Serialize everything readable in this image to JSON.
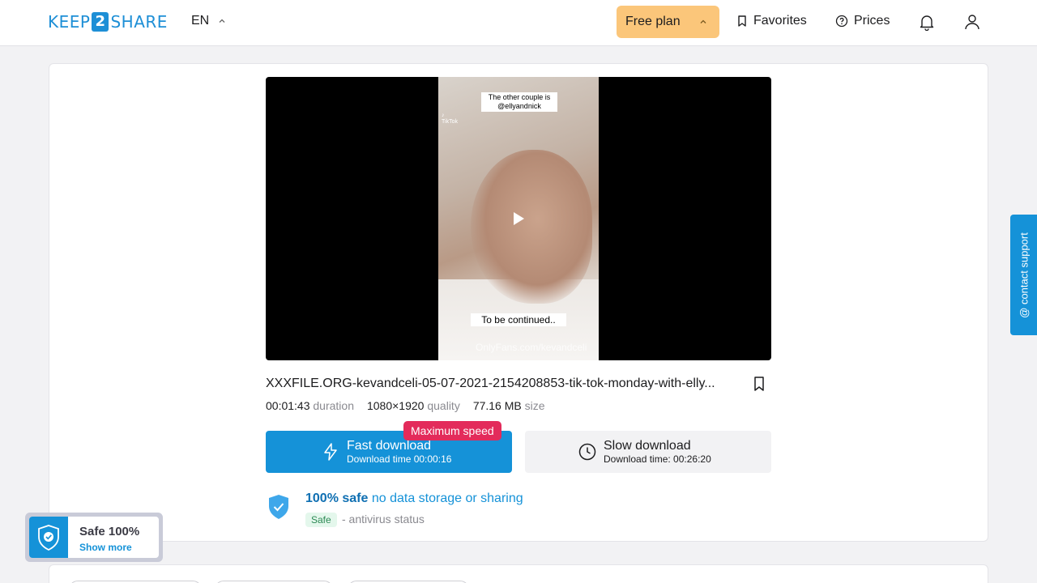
{
  "header": {
    "logo": {
      "pre": "KEEP",
      "num": "2",
      "post": "SHARE"
    },
    "language": "EN",
    "free_plan_label": "Free plan",
    "favorites_label": "Favorites",
    "prices_label": "Prices",
    "icons": {
      "bookmark": "bookmark-icon",
      "help": "help-circle-icon",
      "bell": "bell-icon",
      "user": "user-icon"
    }
  },
  "video": {
    "caption_top": "The other couple is @ellyandnick",
    "caption_bottom": "To be continued..",
    "watermark": "OnlyFans.com/kevandceli",
    "tiktok_label": "TikTok"
  },
  "file": {
    "name": "XXXFILE.ORG-kevandceli-05-07-2021-2154208853-tik-tok-monday-with-elly...",
    "duration_value": "00:01:43",
    "duration_label": "duration",
    "quality_value": "1080×1920",
    "quality_label": "quality",
    "size_value": "77.16 MB",
    "size_label": "size"
  },
  "download": {
    "fast_title": "Fast download",
    "fast_sub": "Download time 00:00:16",
    "max_speed_badge": "Maximum speed",
    "slow_title": "Slow download",
    "slow_sub": "Download time: 00:26:20"
  },
  "safety": {
    "bold": "100% safe",
    "rest": "no data storage or sharing",
    "tag": "Safe",
    "status": "- antivirus status"
  },
  "support_label": "@ contact support",
  "safe_widget": {
    "title": "Safe 100%",
    "link": "Show more"
  },
  "colors": {
    "accent": "#1592d8",
    "plan": "#fbc67a",
    "badge": "#e32b5b"
  }
}
